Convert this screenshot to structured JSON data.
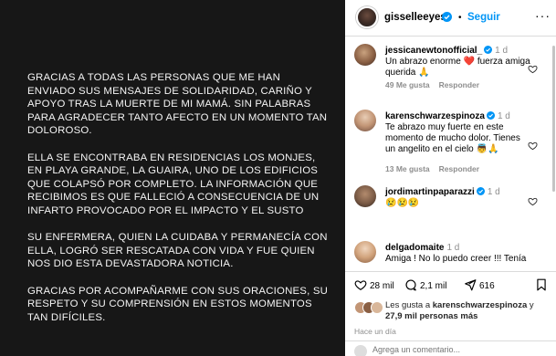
{
  "post": {
    "paragraphs": [
      "GRACIAS A TODAS LAS PERSONAS QUE ME HAN ENVIADO SUS MENSAJES DE SOLIDARIDAD, CARIÑO Y APOYO TRAS LA MUERTE DE MI MAMÁ. SIN PALABRAS PARA AGRADECER TANTO AFECTO EN UN MOMENTO TAN DOLOROSO.",
      "ELLA SE ENCONTRABA EN RESIDENCIAS LOS MONJES, EN PLAYA GRANDE, LA GUAIRA, UNO DE LOS EDIFICIOS QUE COLAPSÓ POR COMPLETO. LA INFORMACIÓN QUE RECIBIMOS ES QUE FALLECIÓ A CONSECUENCIA DE UN INFARTO PROVOCADO POR EL IMPACTO Y EL SUSTO",
      "SU ENFERMERA, QUIEN LA CUIDABA Y PERMANECÍA CON ELLA, LOGRÓ SER RESCATADA CON VIDA Y FUE QUIEN NOS DIO ESTA DEVASTADORA NOTICIA.",
      "GRACIAS POR ACOMPAÑARME CON SUS ORACIONES, SU RESPETO Y SU COMPRENSIÓN EN ESTOS MOMENTOS TAN DIFÍCILES."
    ]
  },
  "header": {
    "username": "gisselleeyes",
    "separator": "•",
    "follow_label": "Seguir",
    "more_label": "···"
  },
  "comments": [
    {
      "username": "jessicanewtonofficial_",
      "time": "1 d",
      "text": "Un abrazo enorme ❤️ fuerza amiga querida 🙏",
      "likes": "49 Me gusta",
      "reply": "Responder"
    },
    {
      "username": "karenschwarzespinoza",
      "time": "1 d",
      "text": "Te abrazo muy fuerte en este momento de mucho dolor. Tienes un angelito en el cielo 👼🙏",
      "likes": "13 Me gusta",
      "reply": "Responder"
    },
    {
      "username": "jordimartinpaparazzi",
      "time": "1 d",
      "text": "😢😢😢",
      "likes": "",
      "reply": ""
    },
    {
      "username": "delgadomaite",
      "time": "1 d",
      "text": "Amiga ! No lo puedo creer !!! Tenía",
      "likes": "",
      "reply": ""
    }
  ],
  "actions": {
    "likes_count": "28 mil",
    "comments_count": "2,1 mil",
    "shares_count": "616"
  },
  "liked_by": {
    "prefix": "Les gusta a ",
    "user": "karenschwarzespinoza",
    "middle": " y",
    "others": "27,9 mil personas más"
  },
  "posted": "Hace un día",
  "add_comment_placeholder": "Agrega un comentario...",
  "colors": {
    "accent": "#0095f6",
    "verified": "#0095f6",
    "post_bg": "#171717",
    "muted": "#8e8e8e"
  }
}
